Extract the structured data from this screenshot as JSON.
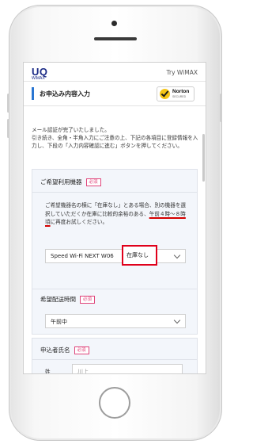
{
  "header": {
    "logo_main": "UQ",
    "logo_sub": "WiMAX",
    "link": "Try WiMAX"
  },
  "page": {
    "title": "お申込み内容入力"
  },
  "badge": {
    "name": "Norton",
    "sub": "SECURED"
  },
  "intro": [
    "メール認証が完了いたしました。",
    "引き続き、全角・半角入力にご注意の上、下記の各項目に登録情報を入力し、下段の「入力内容確認に進む」ボタンを押してください。"
  ],
  "sections": {
    "device": {
      "title": "ご希望利用機器",
      "required": "必須",
      "note_pre": "ご希望機器名の横に「在庫なし」とある場合、別の機器を選択していただくか在庫に比較的余裕のある、",
      "note_em": "午前４時〜８時頃",
      "note_post": "に再度お試しください。",
      "selected": "Speed Wi-Fi NEXT W06",
      "stock": "在庫なし"
    },
    "delivery": {
      "title": "希望配送時間",
      "required": "必須",
      "selected": "午前中"
    },
    "applicant": {
      "title": "申込者氏名",
      "required": "必須",
      "field_label": "姓",
      "field_value": "川上"
    }
  },
  "colors": {
    "accent": "#2a76d2",
    "required": "#e0457b",
    "highlight": "#e0001b"
  }
}
